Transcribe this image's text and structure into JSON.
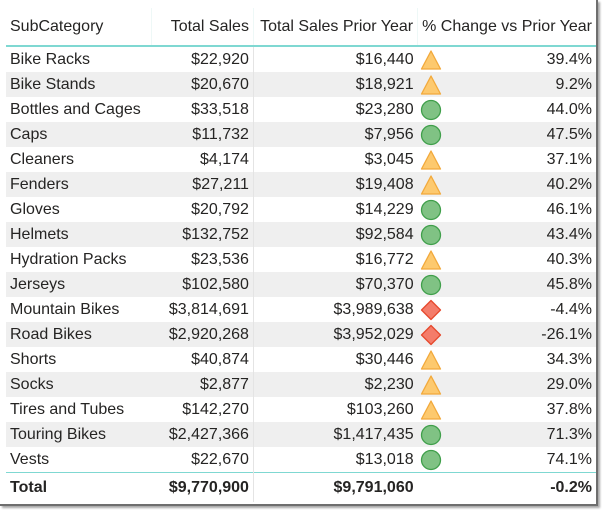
{
  "table": {
    "columns": [
      "SubCategory",
      "Total Sales",
      "Total Sales Prior Year",
      "% Change vs Prior Year"
    ],
    "rows": [
      {
        "subcategory": "Bike Racks",
        "total_sales": "$22,920",
        "prior_year": "$16,440",
        "indicator": "triangle-warning-icon",
        "change": "39.4%"
      },
      {
        "subcategory": "Bike Stands",
        "total_sales": "$20,670",
        "prior_year": "$18,921",
        "indicator": "triangle-warning-icon",
        "change": "9.2%"
      },
      {
        "subcategory": "Bottles and Cages",
        "total_sales": "$33,518",
        "prior_year": "$23,280",
        "indicator": "circle-good-icon",
        "change": "44.0%"
      },
      {
        "subcategory": "Caps",
        "total_sales": "$11,732",
        "prior_year": "$7,956",
        "indicator": "circle-good-icon",
        "change": "47.5%"
      },
      {
        "subcategory": "Cleaners",
        "total_sales": "$4,174",
        "prior_year": "$3,045",
        "indicator": "triangle-warning-icon",
        "change": "37.1%"
      },
      {
        "subcategory": "Fenders",
        "total_sales": "$27,211",
        "prior_year": "$19,408",
        "indicator": "triangle-warning-icon",
        "change": "40.2%"
      },
      {
        "subcategory": "Gloves",
        "total_sales": "$20,792",
        "prior_year": "$14,229",
        "indicator": "circle-good-icon",
        "change": "46.1%"
      },
      {
        "subcategory": "Helmets",
        "total_sales": "$132,752",
        "prior_year": "$92,584",
        "indicator": "circle-good-icon",
        "change": "43.4%"
      },
      {
        "subcategory": "Hydration Packs",
        "total_sales": "$23,536",
        "prior_year": "$16,772",
        "indicator": "triangle-warning-icon",
        "change": "40.3%"
      },
      {
        "subcategory": "Jerseys",
        "total_sales": "$102,580",
        "prior_year": "$70,370",
        "indicator": "circle-good-icon",
        "change": "45.8%"
      },
      {
        "subcategory": "Mountain Bikes",
        "total_sales": "$3,814,691",
        "prior_year": "$3,989,638",
        "indicator": "diamond-bad-icon",
        "change": "-4.4%"
      },
      {
        "subcategory": "Road Bikes",
        "total_sales": "$2,920,268",
        "prior_year": "$3,952,029",
        "indicator": "diamond-bad-icon",
        "change": "-26.1%"
      },
      {
        "subcategory": "Shorts",
        "total_sales": "$40,874",
        "prior_year": "$30,446",
        "indicator": "triangle-warning-icon",
        "change": "34.3%"
      },
      {
        "subcategory": "Socks",
        "total_sales": "$2,877",
        "prior_year": "$2,230",
        "indicator": "triangle-warning-icon",
        "change": "29.0%"
      },
      {
        "subcategory": "Tires and Tubes",
        "total_sales": "$142,270",
        "prior_year": "$103,260",
        "indicator": "triangle-warning-icon",
        "change": "37.8%"
      },
      {
        "subcategory": "Touring Bikes",
        "total_sales": "$2,427,366",
        "prior_year": "$1,417,435",
        "indicator": "circle-good-icon",
        "change": "71.3%"
      },
      {
        "subcategory": "Vests",
        "total_sales": "$22,670",
        "prior_year": "$13,018",
        "indicator": "circle-good-icon",
        "change": "74.1%"
      }
    ],
    "total": {
      "label": "Total",
      "total_sales": "$9,770,900",
      "prior_year": "$9,791,060",
      "change": "-0.2%"
    }
  },
  "colors": {
    "header_rule": "#7fd8d2",
    "good": "#80c284",
    "warning": "#fdc96e",
    "bad": "#f47c6a"
  }
}
